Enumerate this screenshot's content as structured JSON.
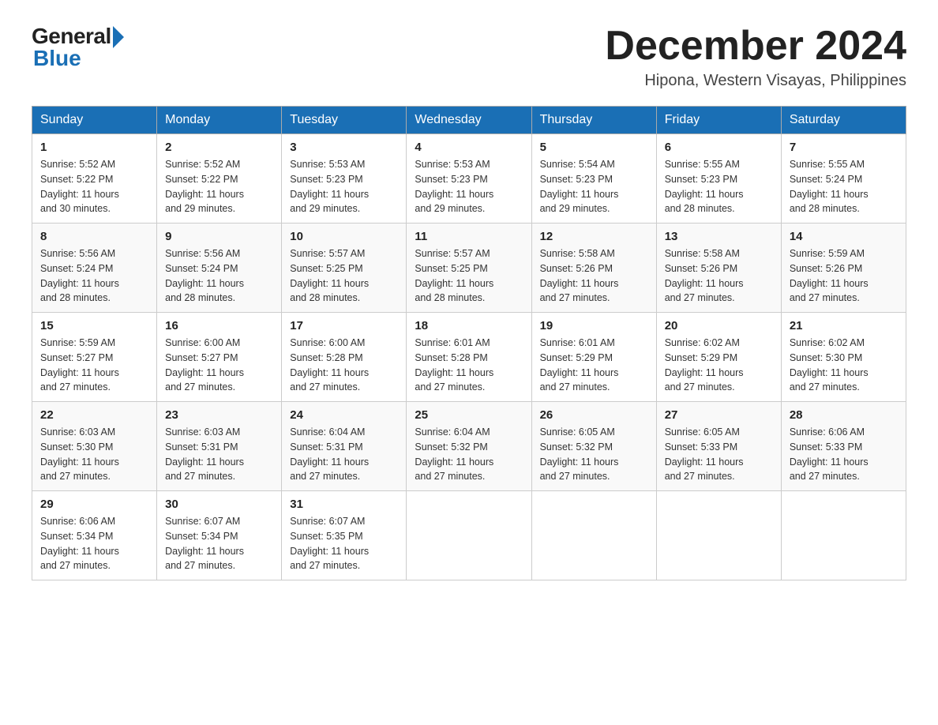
{
  "logo": {
    "general": "General",
    "blue": "Blue"
  },
  "header": {
    "month_year": "December 2024",
    "location": "Hipona, Western Visayas, Philippines"
  },
  "weekdays": [
    "Sunday",
    "Monday",
    "Tuesday",
    "Wednesday",
    "Thursday",
    "Friday",
    "Saturday"
  ],
  "weeks": [
    [
      {
        "day": "1",
        "sunrise": "5:52 AM",
        "sunset": "5:22 PM",
        "daylight": "11 hours and 30 minutes."
      },
      {
        "day": "2",
        "sunrise": "5:52 AM",
        "sunset": "5:22 PM",
        "daylight": "11 hours and 29 minutes."
      },
      {
        "day": "3",
        "sunrise": "5:53 AM",
        "sunset": "5:23 PM",
        "daylight": "11 hours and 29 minutes."
      },
      {
        "day": "4",
        "sunrise": "5:53 AM",
        "sunset": "5:23 PM",
        "daylight": "11 hours and 29 minutes."
      },
      {
        "day": "5",
        "sunrise": "5:54 AM",
        "sunset": "5:23 PM",
        "daylight": "11 hours and 29 minutes."
      },
      {
        "day": "6",
        "sunrise": "5:55 AM",
        "sunset": "5:23 PM",
        "daylight": "11 hours and 28 minutes."
      },
      {
        "day": "7",
        "sunrise": "5:55 AM",
        "sunset": "5:24 PM",
        "daylight": "11 hours and 28 minutes."
      }
    ],
    [
      {
        "day": "8",
        "sunrise": "5:56 AM",
        "sunset": "5:24 PM",
        "daylight": "11 hours and 28 minutes."
      },
      {
        "day": "9",
        "sunrise": "5:56 AM",
        "sunset": "5:24 PM",
        "daylight": "11 hours and 28 minutes."
      },
      {
        "day": "10",
        "sunrise": "5:57 AM",
        "sunset": "5:25 PM",
        "daylight": "11 hours and 28 minutes."
      },
      {
        "day": "11",
        "sunrise": "5:57 AM",
        "sunset": "5:25 PM",
        "daylight": "11 hours and 28 minutes."
      },
      {
        "day": "12",
        "sunrise": "5:58 AM",
        "sunset": "5:26 PM",
        "daylight": "11 hours and 27 minutes."
      },
      {
        "day": "13",
        "sunrise": "5:58 AM",
        "sunset": "5:26 PM",
        "daylight": "11 hours and 27 minutes."
      },
      {
        "day": "14",
        "sunrise": "5:59 AM",
        "sunset": "5:26 PM",
        "daylight": "11 hours and 27 minutes."
      }
    ],
    [
      {
        "day": "15",
        "sunrise": "5:59 AM",
        "sunset": "5:27 PM",
        "daylight": "11 hours and 27 minutes."
      },
      {
        "day": "16",
        "sunrise": "6:00 AM",
        "sunset": "5:27 PM",
        "daylight": "11 hours and 27 minutes."
      },
      {
        "day": "17",
        "sunrise": "6:00 AM",
        "sunset": "5:28 PM",
        "daylight": "11 hours and 27 minutes."
      },
      {
        "day": "18",
        "sunrise": "6:01 AM",
        "sunset": "5:28 PM",
        "daylight": "11 hours and 27 minutes."
      },
      {
        "day": "19",
        "sunrise": "6:01 AM",
        "sunset": "5:29 PM",
        "daylight": "11 hours and 27 minutes."
      },
      {
        "day": "20",
        "sunrise": "6:02 AM",
        "sunset": "5:29 PM",
        "daylight": "11 hours and 27 minutes."
      },
      {
        "day": "21",
        "sunrise": "6:02 AM",
        "sunset": "5:30 PM",
        "daylight": "11 hours and 27 minutes."
      }
    ],
    [
      {
        "day": "22",
        "sunrise": "6:03 AM",
        "sunset": "5:30 PM",
        "daylight": "11 hours and 27 minutes."
      },
      {
        "day": "23",
        "sunrise": "6:03 AM",
        "sunset": "5:31 PM",
        "daylight": "11 hours and 27 minutes."
      },
      {
        "day": "24",
        "sunrise": "6:04 AM",
        "sunset": "5:31 PM",
        "daylight": "11 hours and 27 minutes."
      },
      {
        "day": "25",
        "sunrise": "6:04 AM",
        "sunset": "5:32 PM",
        "daylight": "11 hours and 27 minutes."
      },
      {
        "day": "26",
        "sunrise": "6:05 AM",
        "sunset": "5:32 PM",
        "daylight": "11 hours and 27 minutes."
      },
      {
        "day": "27",
        "sunrise": "6:05 AM",
        "sunset": "5:33 PM",
        "daylight": "11 hours and 27 minutes."
      },
      {
        "day": "28",
        "sunrise": "6:06 AM",
        "sunset": "5:33 PM",
        "daylight": "11 hours and 27 minutes."
      }
    ],
    [
      {
        "day": "29",
        "sunrise": "6:06 AM",
        "sunset": "5:34 PM",
        "daylight": "11 hours and 27 minutes."
      },
      {
        "day": "30",
        "sunrise": "6:07 AM",
        "sunset": "5:34 PM",
        "daylight": "11 hours and 27 minutes."
      },
      {
        "day": "31",
        "sunrise": "6:07 AM",
        "sunset": "5:35 PM",
        "daylight": "11 hours and 27 minutes."
      },
      null,
      null,
      null,
      null
    ]
  ],
  "labels": {
    "sunrise": "Sunrise:",
    "sunset": "Sunset:",
    "daylight": "Daylight:"
  }
}
